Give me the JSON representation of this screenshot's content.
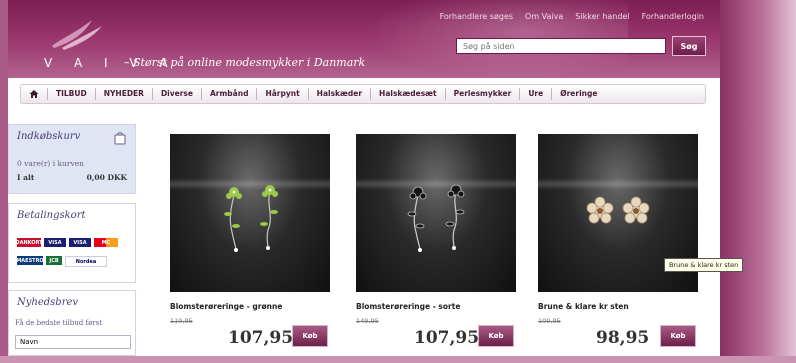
{
  "header": {
    "brand": "V A I V A",
    "tagline": "– Størst på online modesmykker i Danmark",
    "top_links": [
      "Forhandlere søges",
      "Om Vaiva",
      "Sikker handel",
      "Forhandlerlogin"
    ],
    "search_placeholder": "Søg på siden",
    "search_button": "Søg"
  },
  "nav": {
    "items": [
      "TILBUD",
      "NYHEDER",
      "Diverse",
      "Armbånd",
      "Hårpynt",
      "Halskæder",
      "Halskædesæt",
      "Perlesmykker",
      "Ure",
      "Øreringe"
    ]
  },
  "sidebar": {
    "cart": {
      "title": "Indkøbskurv",
      "count_text": "0 vare(r) i kurven",
      "total_label": "I alt",
      "total_value": "0,00 DKK"
    },
    "payment": {
      "title": "Betalingskort",
      "cards": [
        "DANKORT",
        "VISA",
        "VISA",
        "MC",
        "MAESTRO",
        "JCB",
        "Nordea"
      ]
    },
    "newsletter": {
      "title": "Nyhedsbrev",
      "text": "Få de bedste tilbud først",
      "input_value": "Navn"
    }
  },
  "products": [
    {
      "name": "Blomsterøreringe - grønne",
      "old_price": "119,95",
      "price": "107,95",
      "buy": "Køb"
    },
    {
      "name": "Blomsterøreringe - sorte",
      "old_price": "149,95",
      "price": "107,95",
      "buy": "Køb"
    },
    {
      "name": "Brune & klare kr sten",
      "old_price": "109,95",
      "price": "98,95",
      "buy": "Køb"
    }
  ],
  "tooltip": "Brune & klare kr sten",
  "colors": {
    "header": "#8e2b63",
    "accent": "#6d2149",
    "sidebar_title": "#4b3a7a"
  }
}
